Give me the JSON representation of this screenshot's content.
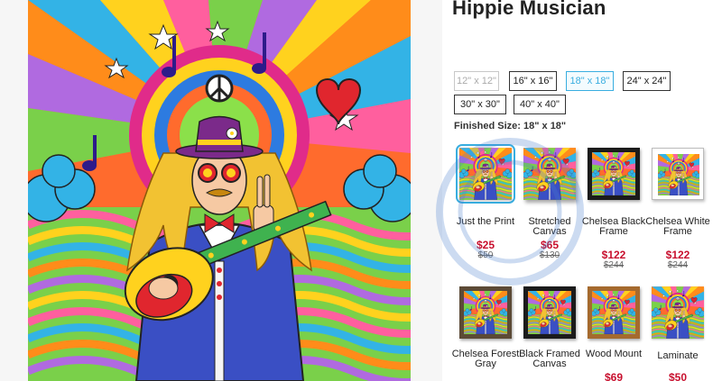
{
  "product": {
    "title": "Hippie Musician"
  },
  "sizes": [
    {
      "label": "12\" x 12\"",
      "state": "disabled"
    },
    {
      "label": "16\" x 16\"",
      "state": "normal"
    },
    {
      "label": "18\" x 18\"",
      "state": "selected"
    },
    {
      "label": "24\" x 24\"",
      "state": "normal"
    },
    {
      "label": "30\" x 30\"",
      "state": "normal"
    },
    {
      "label": "40\" x 40\"",
      "state": "normal"
    }
  ],
  "finished_size": "Finished Size: 18\" x 18\"",
  "products": [
    {
      "name": "Just the Print",
      "price": "$25",
      "old_price": "$50",
      "frame": "none"
    },
    {
      "name": "Stretched Canvas",
      "price": "$65",
      "old_price": "$130",
      "frame": "stretched"
    },
    {
      "name": "Chelsea Black Frame",
      "price": "$122",
      "old_price": "$244",
      "frame": "black"
    },
    {
      "name": "Chelsea White Frame",
      "price": "$122",
      "old_price": "$244",
      "frame": "white"
    },
    {
      "name": "Chelsea Forest Gray",
      "price": "",
      "old_price": "",
      "frame": "gray"
    },
    {
      "name": "Black Framed Canvas",
      "price": "",
      "old_price": "",
      "frame": "black"
    },
    {
      "name": "Wood Mount",
      "price": "$69",
      "old_price": "",
      "frame": "wood"
    },
    {
      "name": "Laminate",
      "price": "$50",
      "old_price": "",
      "frame": "none"
    }
  ],
  "colors": {
    "accent": "#39aee0",
    "sale": "#c8102e"
  }
}
